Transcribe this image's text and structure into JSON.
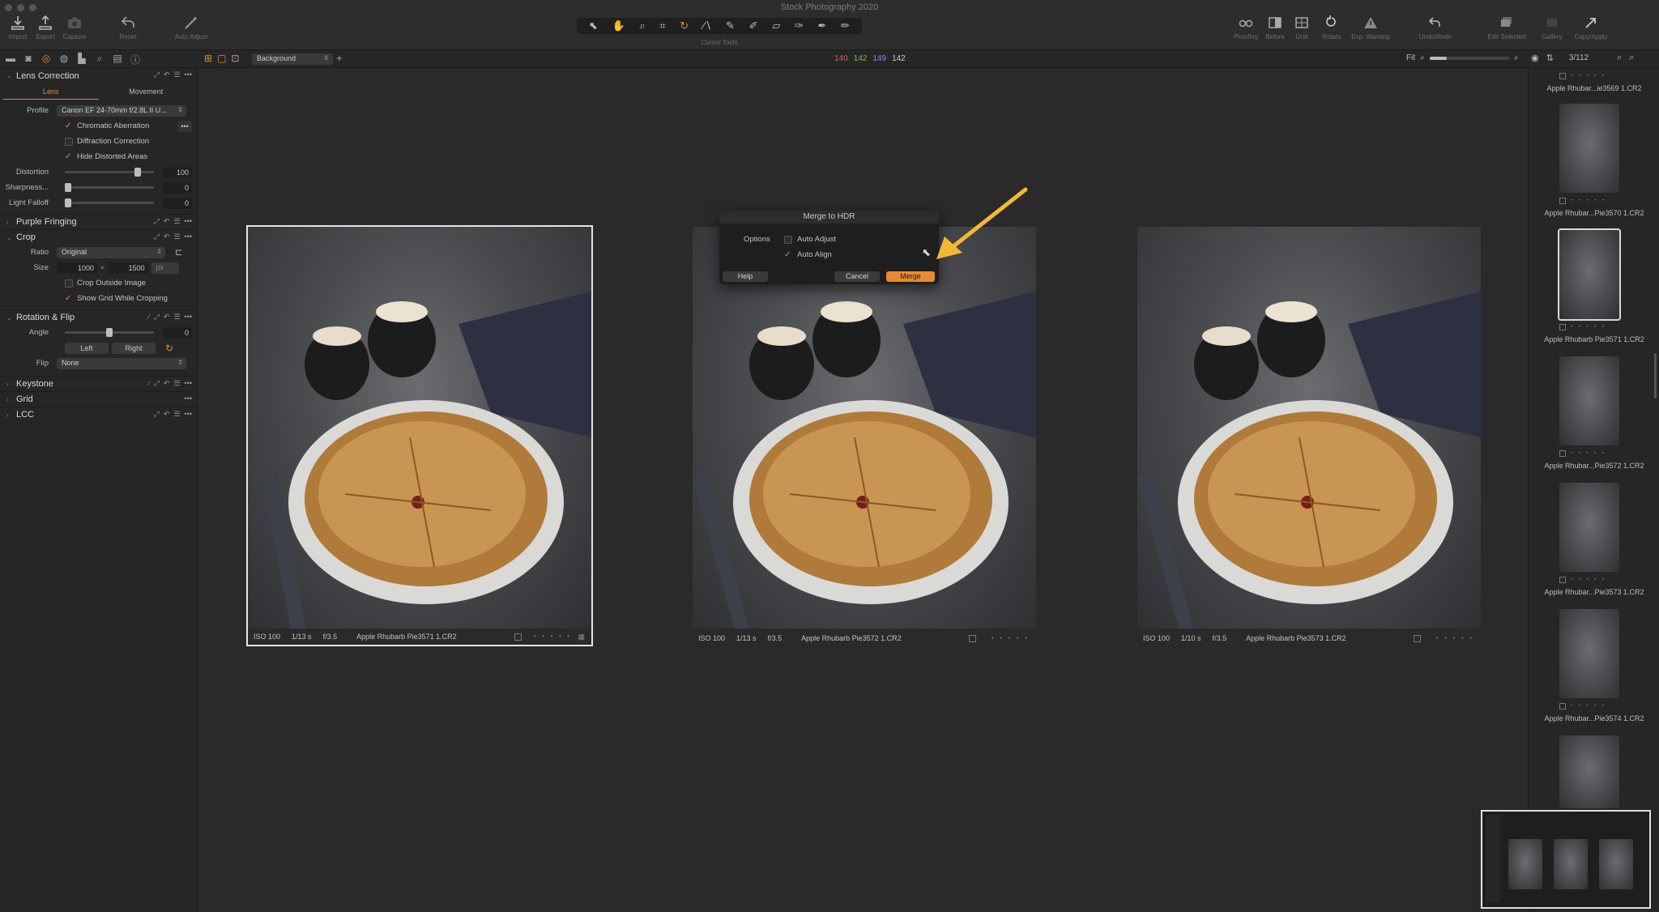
{
  "window": {
    "title": "Stock Photography 2020"
  },
  "toolbar": {
    "left": [
      {
        "icon": "import-icon",
        "label": "Import"
      },
      {
        "icon": "export-icon",
        "label": "Export"
      },
      {
        "icon": "camera-icon",
        "label": "Capture"
      },
      {
        "icon": "reset-icon",
        "label": "Reset"
      },
      {
        "icon": "magic-wand-icon",
        "label": "Auto Adjust"
      }
    ],
    "cursor_tools_label": "Cursor Tools",
    "right": [
      {
        "icon": "glasses-icon",
        "label": "Proofing"
      },
      {
        "icon": "before-after-icon",
        "label": "Before"
      },
      {
        "icon": "grid-icon",
        "label": "Grid"
      },
      {
        "icon": "rotate-icon",
        "label": "Rotate"
      },
      {
        "icon": "warning-icon",
        "label": "Exp. Warning"
      },
      {
        "icon": "undo-redo-icon",
        "label": "Undo/Redo"
      },
      {
        "icon": "edit-selected-icon",
        "label": "Edit Selected"
      },
      {
        "icon": "gallery-icon",
        "label": "Gallery"
      },
      {
        "icon": "copy-apply-icon",
        "label": "Copy/Apply"
      }
    ]
  },
  "viewer_bar": {
    "background_select": "Background",
    "rgb": {
      "r": "140",
      "g": "142",
      "b": "149",
      "l": "142"
    },
    "zoom_label": "Fit",
    "zoom_level": 0.22,
    "counter": "3/112"
  },
  "colors": {
    "accent": "#e88b2e",
    "red": "#e05555",
    "green": "#6cc24a",
    "blue": "#8c8cf0"
  },
  "left_panel": {
    "lens_correction": {
      "title": "Lens Correction",
      "tabs": [
        "Lens",
        "Movement"
      ],
      "profile_label": "Profile",
      "profile_value": "Canon EF 24-70mm f/2.8L II U...",
      "chromatic": "Chromatic Aberration",
      "diffraction": "Diffraction Correction",
      "hide_distorted": "Hide Distorted Areas",
      "distortion_label": "Distortion",
      "distortion_value": "100",
      "sharpness_label": "Sharpness...",
      "sharpness_value": "0",
      "falloff_label": "Light Falloff",
      "falloff_value": "0"
    },
    "purple_fringing": {
      "title": "Purple Fringing"
    },
    "crop": {
      "title": "Crop",
      "ratio_label": "Ratio",
      "ratio_value": "Original",
      "size_label": "Size",
      "width": "1000",
      "times": "×",
      "height": "1500",
      "unit": "px",
      "crop_outside": "Crop Outside Image",
      "show_grid": "Show Grid While Cropping"
    },
    "rotation": {
      "title": "Rotation & Flip",
      "angle_label": "Angle",
      "angle_value": "0",
      "left_btn": "Left",
      "right_btn": "Right",
      "flip_label": "Flip",
      "flip_value": "None"
    },
    "keystone": {
      "title": "Keystone"
    },
    "grid": {
      "title": "Grid"
    },
    "lcc": {
      "title": "LCC"
    }
  },
  "viewer": {
    "images": [
      {
        "iso": "ISO 100",
        "shutter": "1/13 s",
        "aperture": "f/3.5",
        "name": "Apple Rhubarb Pie3571 1.CR2"
      },
      {
        "iso": "ISO 100",
        "shutter": "1/13 s",
        "aperture": "f/3.5",
        "name": "Apple Rhubarb Pie3572 1.CR2"
      },
      {
        "iso": "ISO 100",
        "shutter": "1/10 s",
        "aperture": "f/3.5",
        "name": "Apple Rhubarb Pie3573 1.CR2"
      }
    ],
    "stars": "• • • • •"
  },
  "dialog": {
    "title": "Merge to HDR",
    "options_label": "Options",
    "auto_adjust": "Auto Adjust",
    "auto_align": "Auto Align",
    "help": "Help",
    "cancel": "Cancel",
    "merge": "Merge"
  },
  "browser": {
    "top_name": "Apple Rhubar...ie3569 1.CR2",
    "thumbs": [
      "Apple Rhubar...Pie3570 1.CR2",
      "Apple Rhubarb Pie3571 1.CR2",
      "Apple Rhubar...Pie3572 1.CR2",
      "Apple Rhubar...Pie3573 1.CR2",
      "Apple Rhubar...Pie3574 1.CR2"
    ]
  }
}
